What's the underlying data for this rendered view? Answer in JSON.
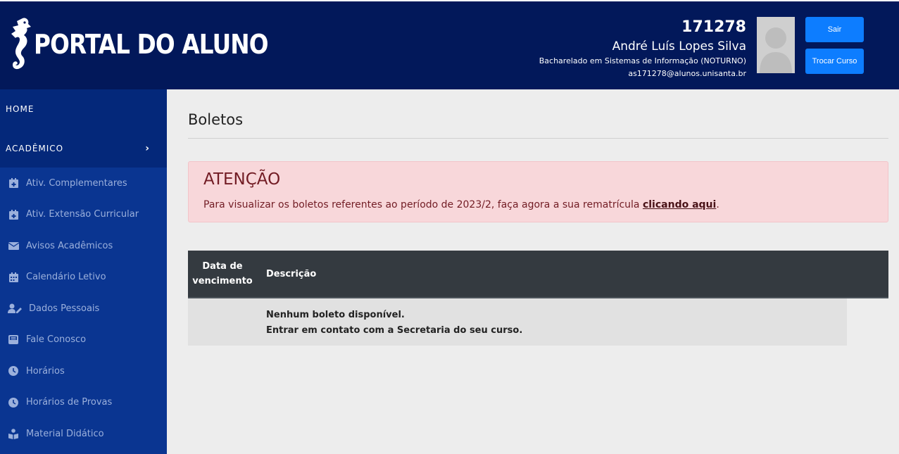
{
  "header": {
    "logo_text": "PORTAL DO ALUNO",
    "user": {
      "id": "171278",
      "name": "André Luís Lopes Silva",
      "course": "Bacharelado em Sistemas de Informação (NOTURNO)",
      "email": "as171278@alunos.unisanta.br"
    },
    "buttons": {
      "logout": "Sair",
      "change_course": "Trocar Curso"
    }
  },
  "sidebar": {
    "home": "HOME",
    "academic": "ACADÊMICO",
    "items": [
      {
        "label": "Ativ. Complementares",
        "icon": "calendar-plus-icon"
      },
      {
        "label": "Ativ. Extensão Curricular",
        "icon": "calendar-plus-icon"
      },
      {
        "label": "Avisos Acadêmicos",
        "icon": "envelope-icon"
      },
      {
        "label": "Calendário Letivo",
        "icon": "calendar-icon"
      },
      {
        "label": "Dados Pessoais",
        "icon": "user-edit-icon"
      },
      {
        "label": "Fale Conosco",
        "icon": "inbox-icon"
      },
      {
        "label": "Horários",
        "icon": "clock-icon"
      },
      {
        "label": "Horários de Provas",
        "icon": "clock-icon"
      },
      {
        "label": "Material Didático",
        "icon": "book-reader-icon"
      }
    ]
  },
  "main": {
    "title": "Boletos",
    "alert": {
      "title": "ATENÇÃO",
      "text_before": "Para visualizar os boletos referentes ao período de 2023/2, faça agora a sua rematrícula ",
      "link": "clicando aqui",
      "text_after": "."
    },
    "table": {
      "headers": {
        "date_line1": "Data de",
        "date_line2": "vencimento",
        "description": "Descrição"
      },
      "empty_line1": "Nenhum boleto disponível.",
      "empty_line2": "Entrar em contato com a Secretaria do seu curso."
    }
  },
  "colors": {
    "header_bg": "#02185a",
    "sidebar_bg": "#0a3591",
    "button": "#0d7dff",
    "alert_bg": "#f8d7da",
    "table_head": "#343a40"
  }
}
